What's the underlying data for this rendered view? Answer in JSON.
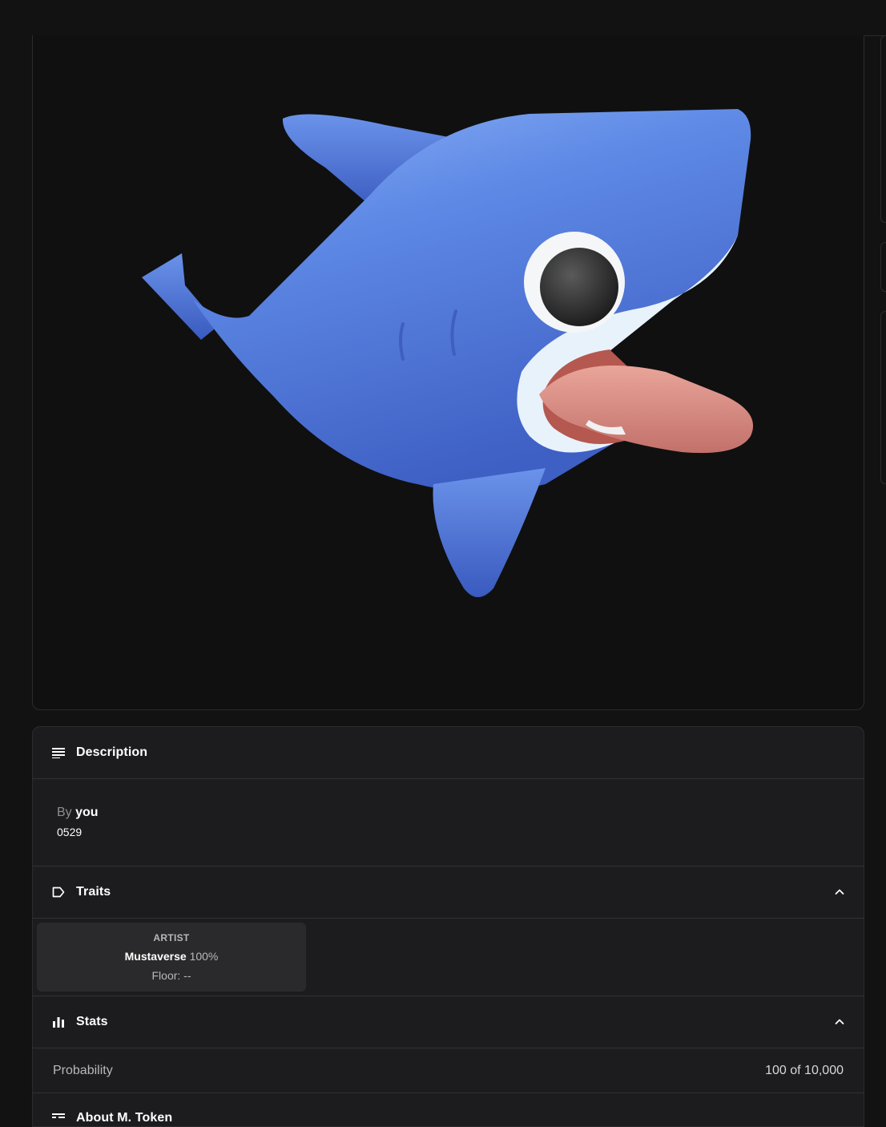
{
  "media": {
    "alt": "blue cartoon shark"
  },
  "description": {
    "title": "Description",
    "by_prefix": "By",
    "by_name": "you",
    "token_id": "0529"
  },
  "traits": {
    "title": "Traits",
    "items": [
      {
        "type": "ARTIST",
        "value": "Mustaverse",
        "percent": "100%",
        "floor": "Floor: --"
      }
    ]
  },
  "stats": {
    "title": "Stats",
    "rows": [
      {
        "label": "Probability",
        "value": "100 of 10,000"
      }
    ]
  },
  "about": {
    "title": "About M. Token"
  },
  "colors": {
    "page_bg": "#121213",
    "panel_bg": "#1c1c1e",
    "border": "#2c2c2e",
    "shark_blue": "#4e79dc",
    "tongue": "#d98a80"
  },
  "icons": {
    "description": "list-lines-icon",
    "traits": "tag-icon",
    "stats": "bar-chart-icon",
    "about": "list-detail-icon",
    "chevron": "chevron-up-icon"
  }
}
